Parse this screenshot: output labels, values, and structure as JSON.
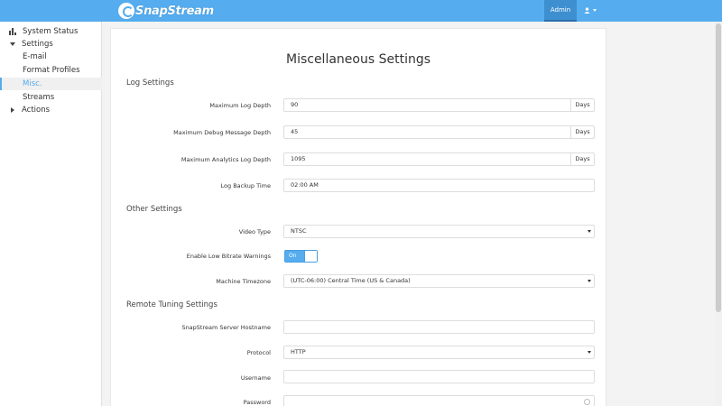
{
  "header": {
    "brand": "SnapStream",
    "admin_label": "Admin",
    "user_icon": "user-icon",
    "accent": "#55acee"
  },
  "sidebar": {
    "items": [
      {
        "label": "System Status",
        "icon": "bar-chart-icon"
      },
      {
        "label": "Settings",
        "icon": "caret-down-icon"
      },
      {
        "label": "E-mail"
      },
      {
        "label": "Format Profiles"
      },
      {
        "label": "Misc."
      },
      {
        "label": "Streams"
      },
      {
        "label": "Actions",
        "icon": "caret-right-icon"
      }
    ]
  },
  "main": {
    "title": "Miscellaneous Settings",
    "log_settings": {
      "heading": "Log Settings",
      "max_log_depth": {
        "label": "Maximum Log Depth",
        "value": "90",
        "unit": "Days"
      },
      "max_debug_depth": {
        "label": "Maximum Debug Message Depth",
        "value": "45",
        "unit": "Days"
      },
      "max_analytics_depth": {
        "label": "Maximum Analytics Log Depth",
        "value": "1095",
        "unit": "Days"
      },
      "backup_time": {
        "label": "Log Backup Time",
        "value": "02:00 AM"
      }
    },
    "other_settings": {
      "heading": "Other Settings",
      "video_type": {
        "label": "Video Type",
        "value": "NTSC"
      },
      "low_bitrate": {
        "label": "Enable Low Bitrate Warnings",
        "value": "On"
      },
      "timezone": {
        "label": "Machine Timezone",
        "value": "(UTC-06:00) Central Time (US & Canada)"
      }
    },
    "remote_tuning": {
      "heading": "Remote Tuning Settings",
      "hostname": {
        "label": "SnapStream Server Hostname",
        "value": ""
      },
      "protocol": {
        "label": "Protocol",
        "value": "HTTP"
      },
      "username": {
        "label": "Username",
        "value": ""
      },
      "password": {
        "label": "Password",
        "value": ""
      }
    }
  }
}
